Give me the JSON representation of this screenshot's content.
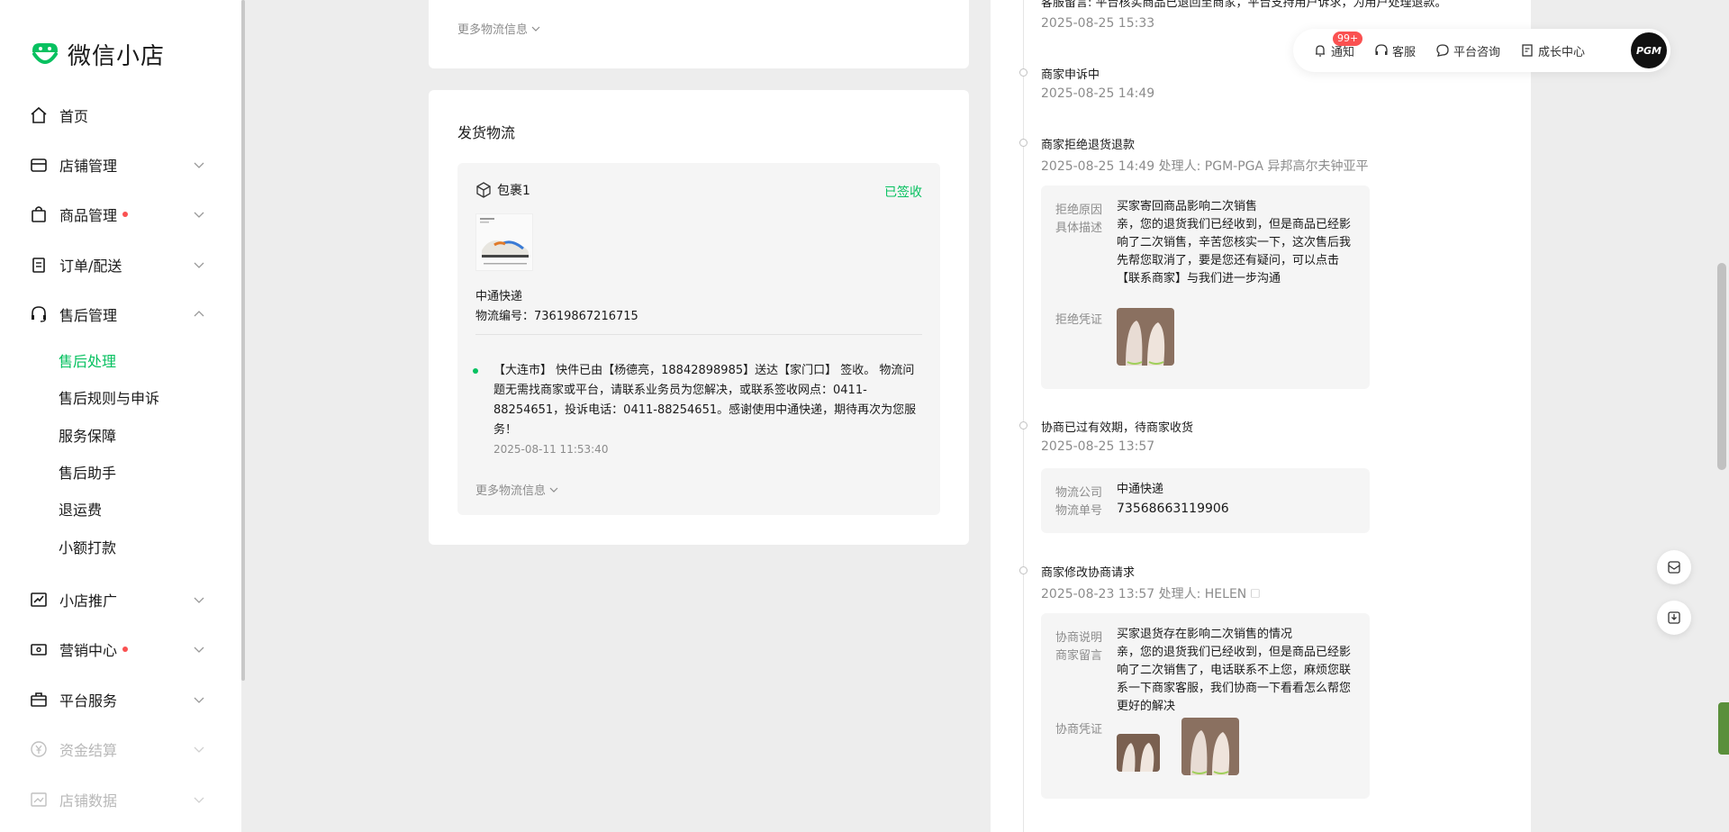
{
  "app": {
    "title": "微信小店"
  },
  "sidebar": {
    "items": [
      {
        "label": "首页",
        "icon": "home-icon"
      },
      {
        "label": "店铺管理",
        "icon": "store-icon"
      },
      {
        "label": "商品管理",
        "icon": "bag-icon",
        "dot": true
      },
      {
        "label": "订单/配送",
        "icon": "clipboard-icon"
      },
      {
        "label": "售后管理",
        "icon": "headset-icon",
        "expanded": true
      },
      {
        "label": "小店推广",
        "icon": "trend-icon"
      },
      {
        "label": "营销中心",
        "icon": "ticket-icon",
        "dot": true
      },
      {
        "label": "平台服务",
        "icon": "briefcase-icon"
      },
      {
        "label": "资金结算",
        "icon": "yuan-icon",
        "disabled": true
      },
      {
        "label": "店铺数据",
        "icon": "chart-icon",
        "disabled": true
      }
    ],
    "subitems": [
      "售后处理",
      "售后规则与申诉",
      "服务保障",
      "售后助手",
      "退运费",
      "小额打款"
    ],
    "active_sub": "售后处理"
  },
  "topbar": {
    "notify_label": "通知",
    "notify_badge": "99+",
    "service_label": "客服",
    "consult_label": "平台咨询",
    "growth_label": "成长中心",
    "avatar_text": "PGM"
  },
  "top_card": {
    "more_label": "更多物流信息"
  },
  "shipping": {
    "title": "发货物流",
    "package_label": "包裹1",
    "status": "已签收",
    "carrier": "中通快递",
    "tracking_no": "物流编号：73619867216715",
    "track_text": "【大连市】 快件已由【杨德亮，18842898985】送达【家门口】 签收。 物流问题无需找商家或平台，请联系业务员为您解决，或联系签收网点：0411-88254651，投诉电话：0411-88254651。感谢使用中通快递，期待再次为您服务！",
    "track_time": "2025-08-11 11:53:40",
    "more_label": "更多物流信息"
  },
  "timeline": {
    "top_cut_text": "客服留言: 平台核实商品已退回至商家，平台支持用户诉求，为用户处理退款。",
    "top_cut_time": "2025-08-25 15:33",
    "events": [
      {
        "title": "商家申诉中",
        "sub": "2025-08-25 14:49"
      },
      {
        "title": "商家拒绝退货退款",
        "sub": "2025-08-25 14:49 处理人: PGM-PGA 异邦高尔夫钟亚平"
      },
      {
        "title": "协商已过有效期，待商家收货",
        "sub": "2025-08-25 13:57"
      },
      {
        "title": "商家修改协商请求",
        "sub": "2025-08-23 13:57 处理人: HELEN 🗆"
      }
    ],
    "reject": {
      "reason_key": "拒绝原因",
      "reason_val": "买家寄回商品影响二次销售",
      "desc_key": "具体描述",
      "desc_val": "亲，您的退货我们已经收到，但是商品已经影响了二次销售，辛苦您核实一下，这次售后我先帮您取消了，要是您还有疑问，可以点击【联系商家】与我们进一步沟通",
      "proof_key": "拒绝凭证"
    },
    "logistics": {
      "company_key": "物流公司",
      "company_val": "中通快递",
      "no_key": "物流单号",
      "no_val": "73568663119906"
    },
    "negotiate": {
      "note_key": "协商说明",
      "note_val": "买家退货存在影响二次销售的情况",
      "msg_key": "商家留言",
      "msg_val": "亲，您的退货我们已经收到，但是商品已经影响了二次销售了，电话联系不上您，麻烦您联系一下商家客服，我们协商一下看看怎么帮您更好的解决",
      "proof_key": "协商凭证"
    }
  },
  "colors": {
    "accent": "#07c160",
    "badge": "#fa5151"
  }
}
